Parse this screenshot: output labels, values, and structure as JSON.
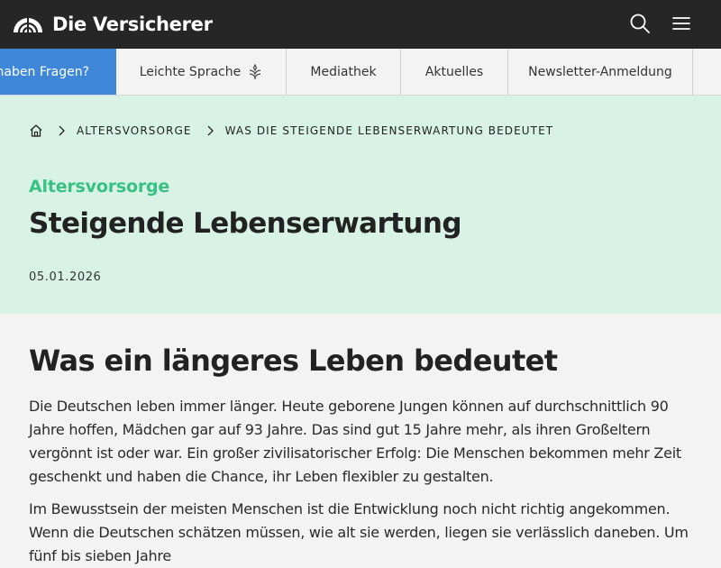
{
  "header": {
    "brand": "Die Versicherer",
    "icons": [
      "search-icon",
      "menu-icon"
    ]
  },
  "nav": {
    "items": [
      {
        "label": "Sie haben Fragen?",
        "icon": null
      },
      {
        "label": "Leichte Sprache",
        "icon": "easy-language-icon"
      },
      {
        "label": "Mediathek",
        "icon": null
      },
      {
        "label": "Aktuelles",
        "icon": null
      },
      {
        "label": "Newsletter-Anmeldung",
        "icon": null
      }
    ]
  },
  "breadcrumb": {
    "items": [
      "Altersvorsorge",
      "Was die steigende Lebenserwartung bedeutet"
    ]
  },
  "hero": {
    "category": "Altersvorsorge",
    "title": "Steigende Lebenserwartung",
    "date": "05.01.2026"
  },
  "article": {
    "heading": "Was ein längeres Leben bedeutet",
    "paragraphs": [
      "Die Deutschen leben immer länger. Heute geborene Jungen können auf durchschnittlich 90 Jahre hoffen, Mädchen gar auf 93 Jahre. Das sind gut 15 Jahre mehr, als ihren Großeltern vergönnt ist oder war. Ein großer zivilisatorischer Erfolg: Die Menschen bekommen mehr Zeit geschenkt und haben die Chance, ihr Leben flexibler zu gestalten.",
      "Im Bewusstsein der meisten Menschen ist die Entwicklung noch nicht richtig angekommen. Wenn die Deutschen schätzen müssen, wie alt sie werden, liegen sie verlässlich daneben. Um fünf bis sieben Jahre"
    ]
  },
  "colors": {
    "topbar": "#262626",
    "accent_blue": "#3d86d8",
    "hero_bg": "#d8f3e6",
    "category_green": "#37c183"
  }
}
